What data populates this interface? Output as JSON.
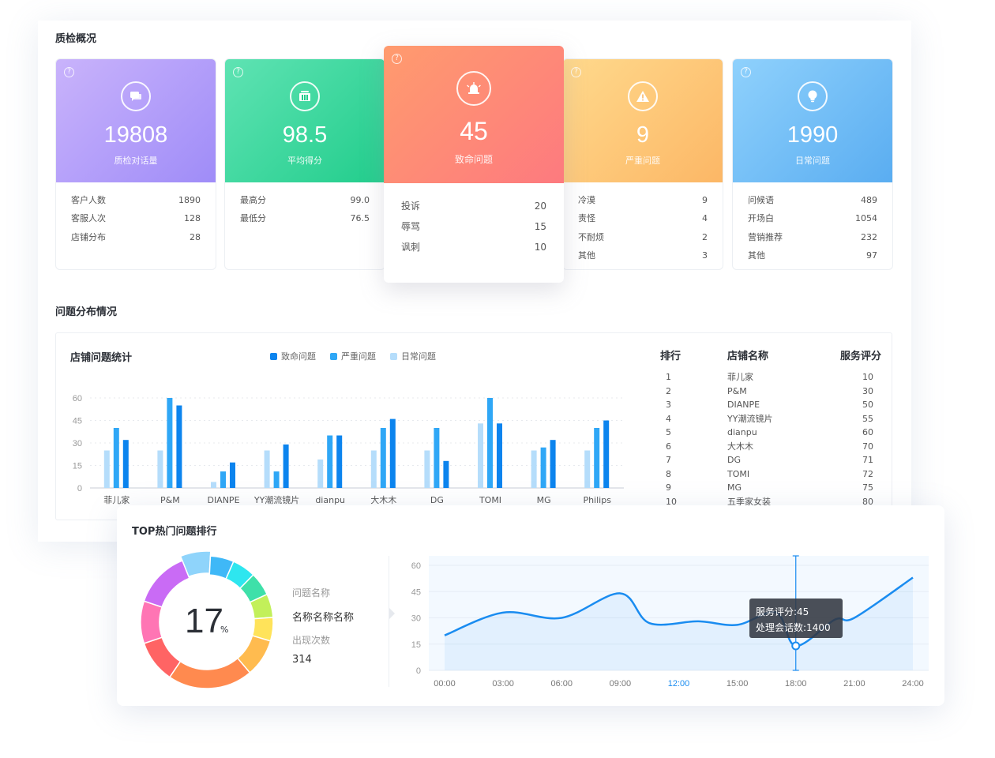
{
  "overview": {
    "title": "质检概况",
    "cards": [
      {
        "value": "19808",
        "label": "质检对话量",
        "icon": "chat-icon",
        "rows": [
          {
            "k": "客户人数",
            "v": "1890"
          },
          {
            "k": "客服人次",
            "v": "128"
          },
          {
            "k": "店铺分布",
            "v": "28"
          }
        ]
      },
      {
        "value": "98.5",
        "label": "平均得分",
        "icon": "gift-icon",
        "rows": [
          {
            "k": "最高分",
            "v": "99.0"
          },
          {
            "k": "最低分",
            "v": "76.5"
          }
        ]
      },
      {
        "value": "45",
        "label": "致命问题",
        "icon": "alarm-icon",
        "rows": [
          {
            "k": "投诉",
            "v": "20"
          },
          {
            "k": "辱骂",
            "v": "15"
          },
          {
            "k": "讽刺",
            "v": "10"
          }
        ]
      },
      {
        "value": "9",
        "label": "严重问题",
        "icon": "warning-icon",
        "rows": [
          {
            "k": "冷漠",
            "v": "9"
          },
          {
            "k": "责怪",
            "v": "4"
          },
          {
            "k": "不耐烦",
            "v": "2"
          },
          {
            "k": "其他",
            "v": "3"
          }
        ]
      },
      {
        "value": "1990",
        "label": "日常问题",
        "icon": "lightbulb-icon",
        "rows": [
          {
            "k": "问候语",
            "v": "489"
          },
          {
            "k": "开场白",
            "v": "1054"
          },
          {
            "k": "营销推荐",
            "v": "232"
          },
          {
            "k": "其他",
            "v": "97"
          }
        ]
      }
    ],
    "colors": {
      "purple": [
        "#c9b3fb",
        "#9f8cf8"
      ],
      "green": [
        "#5fe3b3",
        "#22cd8c"
      ],
      "red": [
        "#ff9b6e",
        "#fd7a7f"
      ],
      "yellow": [
        "#ffd98c",
        "#fcb766"
      ],
      "blue": [
        "#8fd1fc",
        "#5aadf1"
      ]
    }
  },
  "distribution": {
    "title": "问题分布情况",
    "chart_title": "店铺问题统计"
  },
  "chart_data": [
    {
      "type": "bar",
      "title": "店铺问题统计",
      "categories": [
        "菲儿家",
        "P&M",
        "DIANPE",
        "YY潮流镜片",
        "dianpu",
        "大木木",
        "DG",
        "TOMI",
        "MG",
        "Philips"
      ],
      "series": [
        {
          "name": "日常问题",
          "color": "#b5ddfb",
          "values": [
            25,
            25,
            4,
            25,
            19,
            25,
            25,
            43,
            25,
            25
          ]
        },
        {
          "name": "严重问题",
          "color": "#2fa7f6",
          "values": [
            40,
            60,
            11,
            11,
            35,
            40,
            40,
            60,
            27,
            40
          ]
        },
        {
          "name": "致命问题",
          "color": "#0c84ee",
          "values": [
            32,
            55,
            17,
            29,
            35,
            46,
            18,
            43,
            32,
            45
          ]
        }
      ],
      "yticks": [
        0,
        15,
        30,
        45,
        60
      ],
      "ylim": [
        0,
        60
      ],
      "legend_order": [
        "致命问题",
        "严重问题",
        "日常问题"
      ],
      "legend_position": "top-center",
      "grid": true
    },
    {
      "type": "line",
      "x": [
        "00:00",
        "03:00",
        "06:00",
        "09:00",
        "12:00",
        "15:00",
        "18:00",
        "21:00",
        "24:00"
      ],
      "values": [
        20,
        33,
        30,
        44,
        27,
        28,
        26,
        33,
        14,
        29,
        30,
        53
      ],
      "x_positions_hours": [
        0,
        3,
        6,
        9,
        10.5,
        13,
        15,
        17,
        18,
        20,
        21,
        24
      ],
      "yticks": [
        0,
        15,
        30,
        45,
        60
      ],
      "ylim": [
        0,
        60
      ],
      "highlight_x": "12:00",
      "tooltip_at": "18:00",
      "grid": true
    }
  ],
  "ranking": {
    "headers": [
      "排行",
      "店铺名称",
      "服务评分"
    ],
    "rows": [
      [
        "1",
        "菲儿家",
        "10"
      ],
      [
        "2",
        "P&M",
        "30"
      ],
      [
        "3",
        "DIANPE",
        "50"
      ],
      [
        "4",
        "YY潮流镜片",
        "55"
      ],
      [
        "5",
        "dianpu",
        "60"
      ],
      [
        "6",
        "大木木",
        "70"
      ],
      [
        "7",
        "DG",
        "71"
      ],
      [
        "8",
        "TOMI",
        "72"
      ],
      [
        "9",
        "MG",
        "75"
      ],
      [
        "10",
        "五季家女装",
        "80"
      ]
    ]
  },
  "top_issues": {
    "title": "TOP热门问题排行",
    "donut_value": "17",
    "donut_unit": "%",
    "name_label": "问题名称",
    "name_value": "名称名称名称",
    "count_label": "出现次数",
    "count_value": "314",
    "tooltip_line1": "服务评分:45",
    "tooltip_line2": "处理会话数:1400",
    "donut_segments": [
      {
        "color": "#8fd4fb",
        "value": 6,
        "highlight": true
      },
      {
        "color": "#3fb8f7",
        "value": 5
      },
      {
        "color": "#2ee6ef",
        "value": 5
      },
      {
        "color": "#3ee0a9",
        "value": 5
      },
      {
        "color": "#c2f05a",
        "value": 5
      },
      {
        "color": "#ffe35a",
        "value": 5
      },
      {
        "color": "#ffbb4f",
        "value": 8
      },
      {
        "color": "#ff8a4f",
        "value": 18
      },
      {
        "color": "#ff6464",
        "value": 9
      },
      {
        "color": "#ff75b4",
        "value": 9
      },
      {
        "color": "#c96bf5",
        "value": 12
      }
    ]
  }
}
